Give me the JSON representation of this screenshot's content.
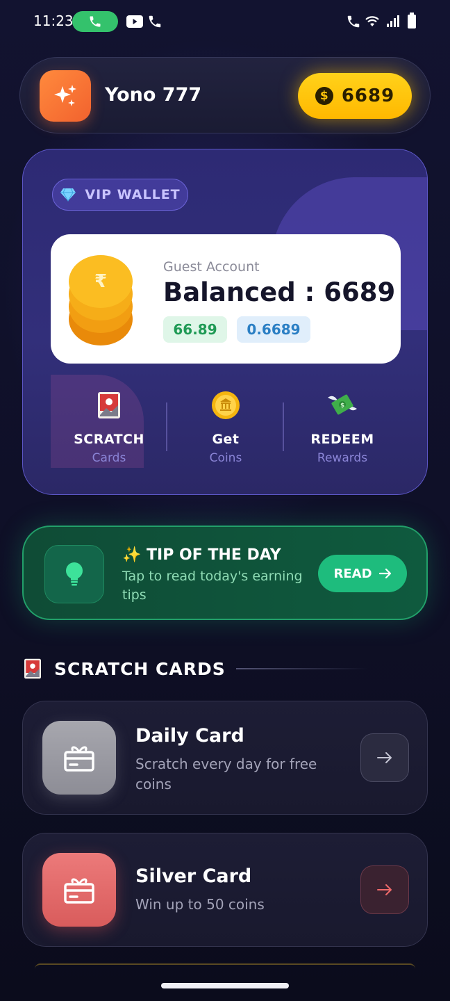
{
  "status_bar": {
    "time": "11:23"
  },
  "header": {
    "app_name": "Yono 777",
    "coin_balance": "6689"
  },
  "wallet": {
    "badge_label": "VIP WALLET",
    "account_label": "Guest Account",
    "balance_text": "Balanced : 6689",
    "chip_green": "66.89",
    "chip_blue": "0.6689",
    "actions": [
      {
        "title": "SCRATCH",
        "subtitle": "Cards",
        "icon": "scratch-card-icon"
      },
      {
        "title": "Get",
        "subtitle": "Coins",
        "icon": "coin-icon"
      },
      {
        "title": "REDEEM",
        "subtitle": "Rewards",
        "icon": "money-wings-icon"
      }
    ]
  },
  "tip": {
    "title": "✨ TIP OF THE DAY",
    "subtitle": "Tap to read today's earning tips",
    "button_label": "READ"
  },
  "scratch_section": {
    "title": "SCRATCH CARDS",
    "cards": [
      {
        "title": "Daily Card",
        "subtitle": "Scratch every day for free coins",
        "color": "#9a9aa2"
      },
      {
        "title": "Silver Card",
        "subtitle": "Win up to 50 coins",
        "color": "#e06666"
      }
    ]
  },
  "colors": {
    "accent_gold": "#ffc20a",
    "accent_green": "#1ebc7d",
    "wallet_purple": "#322f7a"
  }
}
